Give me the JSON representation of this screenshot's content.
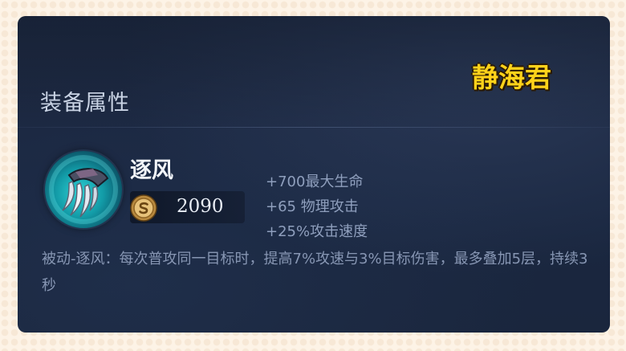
{
  "panel": {
    "section_title": "装备属性",
    "watermark": "静海君"
  },
  "item": {
    "name": "逐风",
    "icon": "claw-blade-icon",
    "price_icon": "gold-coin-icon",
    "price": "2090",
    "stats": [
      "+700最大生命",
      "+65 物理攻击",
      "+25%攻击速度"
    ],
    "passive": "被动-逐风：每次普攻同一目标时，提高7%攻速与3%目标伤害，最多叠加5层，持续3秒"
  },
  "colors": {
    "panel_bg": "#1b2740",
    "title_text": "#c9d3e4",
    "stat_text": "#8f9fbd",
    "watermark": "#ffd21a",
    "icon_glow": "#2fd3d6",
    "frame": "#fdf3e6"
  }
}
